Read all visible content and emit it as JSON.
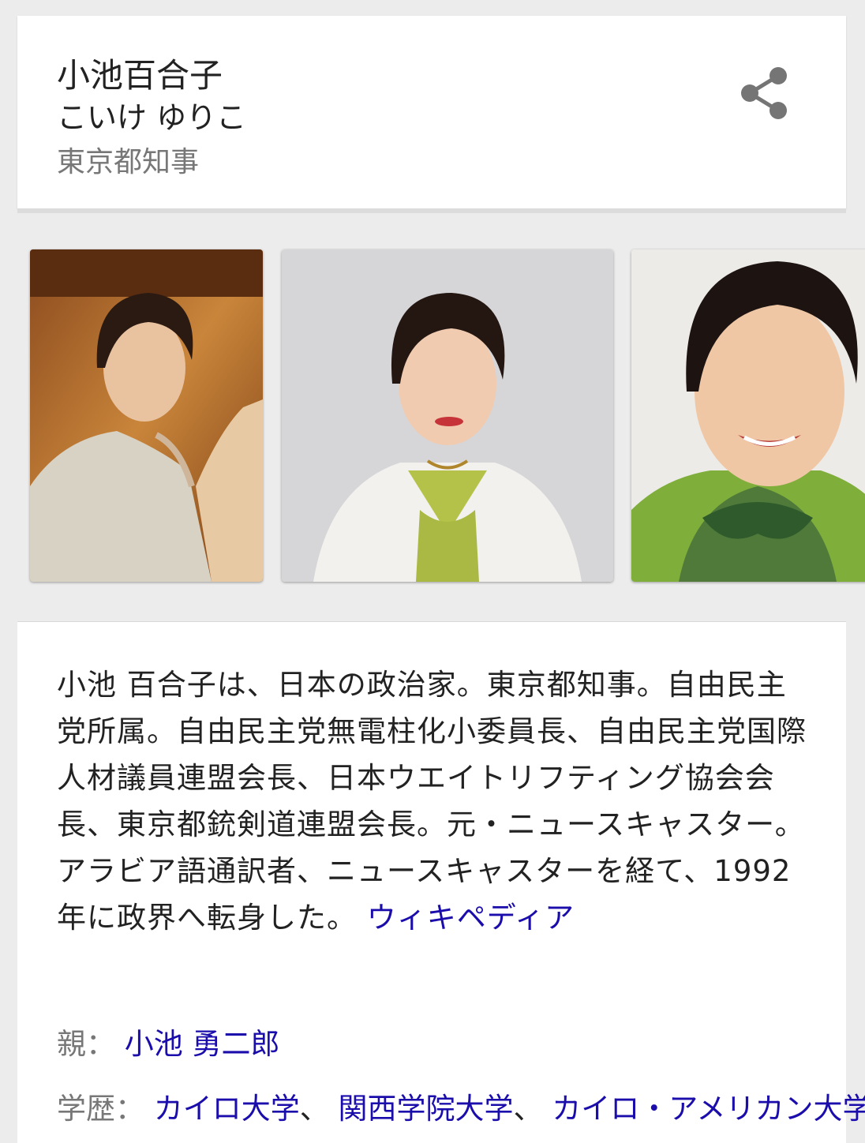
{
  "header": {
    "name": "小池百合子",
    "reading": "こいけ ゆりこ",
    "title": "東京都知事"
  },
  "images": [
    {
      "alt": "小池百合子 photo 1"
    },
    {
      "alt": "小池百合子 photo 2"
    },
    {
      "alt": "小池百合子 photo 3"
    }
  ],
  "description": {
    "text": "小池 百合子は、日本の政治家。東京都知事。自由民主党所属。自由民主党無電柱化小委員長、自由民主党国際人材議員連盟会長、日本ウエイトリフティング協会会長、東京都銃剣道連盟会長。元・ニュースキャスター。 アラビア語通訳者、ニュースキャスターを経て、1992年に政界へ転身した。 ",
    "source_link": "ウィキペディア"
  },
  "facts": {
    "parent_label": "親：",
    "parent_value": "小池 勇二郎",
    "education_label": "学歴：",
    "education_values": [
      "カイロ大学",
      "関西学院大学",
      "カイロ・アメリカン大学"
    ],
    "separator": "、"
  },
  "colors": {
    "link": "#1a0dab",
    "secondary_text": "#777777",
    "background": "#ececec"
  },
  "icons": {
    "share": "share-icon"
  }
}
